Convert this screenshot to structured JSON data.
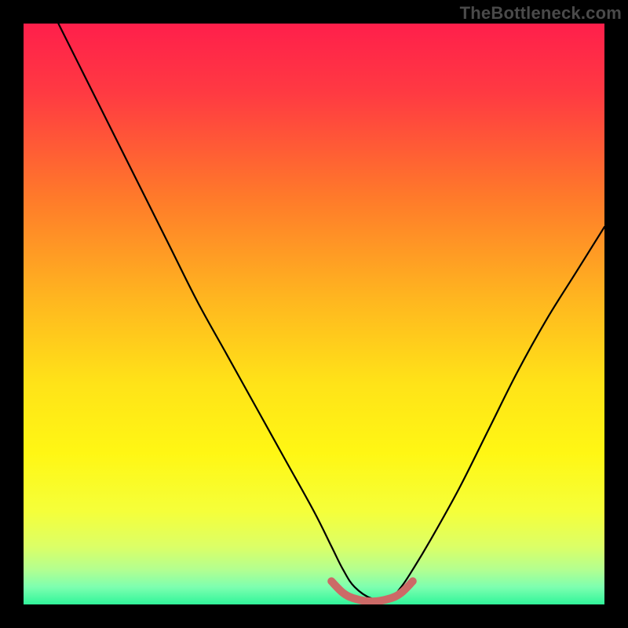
{
  "watermark": "TheBottleneck.com",
  "chart_data": {
    "type": "line",
    "title": "",
    "xlabel": "",
    "ylabel": "",
    "xlim": [
      0,
      100
    ],
    "ylim": [
      0,
      100
    ],
    "grid": false,
    "series": [
      {
        "name": "bottleneck-curve",
        "x": [
          6,
          10,
          15,
          20,
          25,
          30,
          35,
          40,
          45,
          50,
          53,
          55,
          57,
          60,
          63,
          65,
          67,
          70,
          75,
          80,
          85,
          90,
          95,
          100
        ],
        "y": [
          100,
          92,
          82,
          72,
          62,
          52,
          43,
          34,
          25,
          16,
          10,
          6,
          3,
          1,
          1,
          3,
          6,
          11,
          20,
          30,
          40,
          49,
          57,
          65
        ]
      },
      {
        "name": "optimal-band",
        "x": [
          53,
          55,
          57,
          60,
          63,
          65,
          67
        ],
        "y": [
          4,
          2,
          1,
          0.5,
          1,
          2,
          4
        ]
      }
    ],
    "annotations": [],
    "background_gradient": {
      "stops": [
        {
          "offset": 0.0,
          "color": "#ff1f4b"
        },
        {
          "offset": 0.12,
          "color": "#ff3a42"
        },
        {
          "offset": 0.3,
          "color": "#ff7a2a"
        },
        {
          "offset": 0.48,
          "color": "#ffb81f"
        },
        {
          "offset": 0.62,
          "color": "#ffe318"
        },
        {
          "offset": 0.74,
          "color": "#fff714"
        },
        {
          "offset": 0.84,
          "color": "#f5ff3a"
        },
        {
          "offset": 0.9,
          "color": "#dcff66"
        },
        {
          "offset": 0.94,
          "color": "#b3ff90"
        },
        {
          "offset": 0.97,
          "color": "#7dffb0"
        },
        {
          "offset": 1.0,
          "color": "#30f59a"
        }
      ]
    },
    "curve_color": "#000000",
    "band_color": "#cc6a67"
  }
}
